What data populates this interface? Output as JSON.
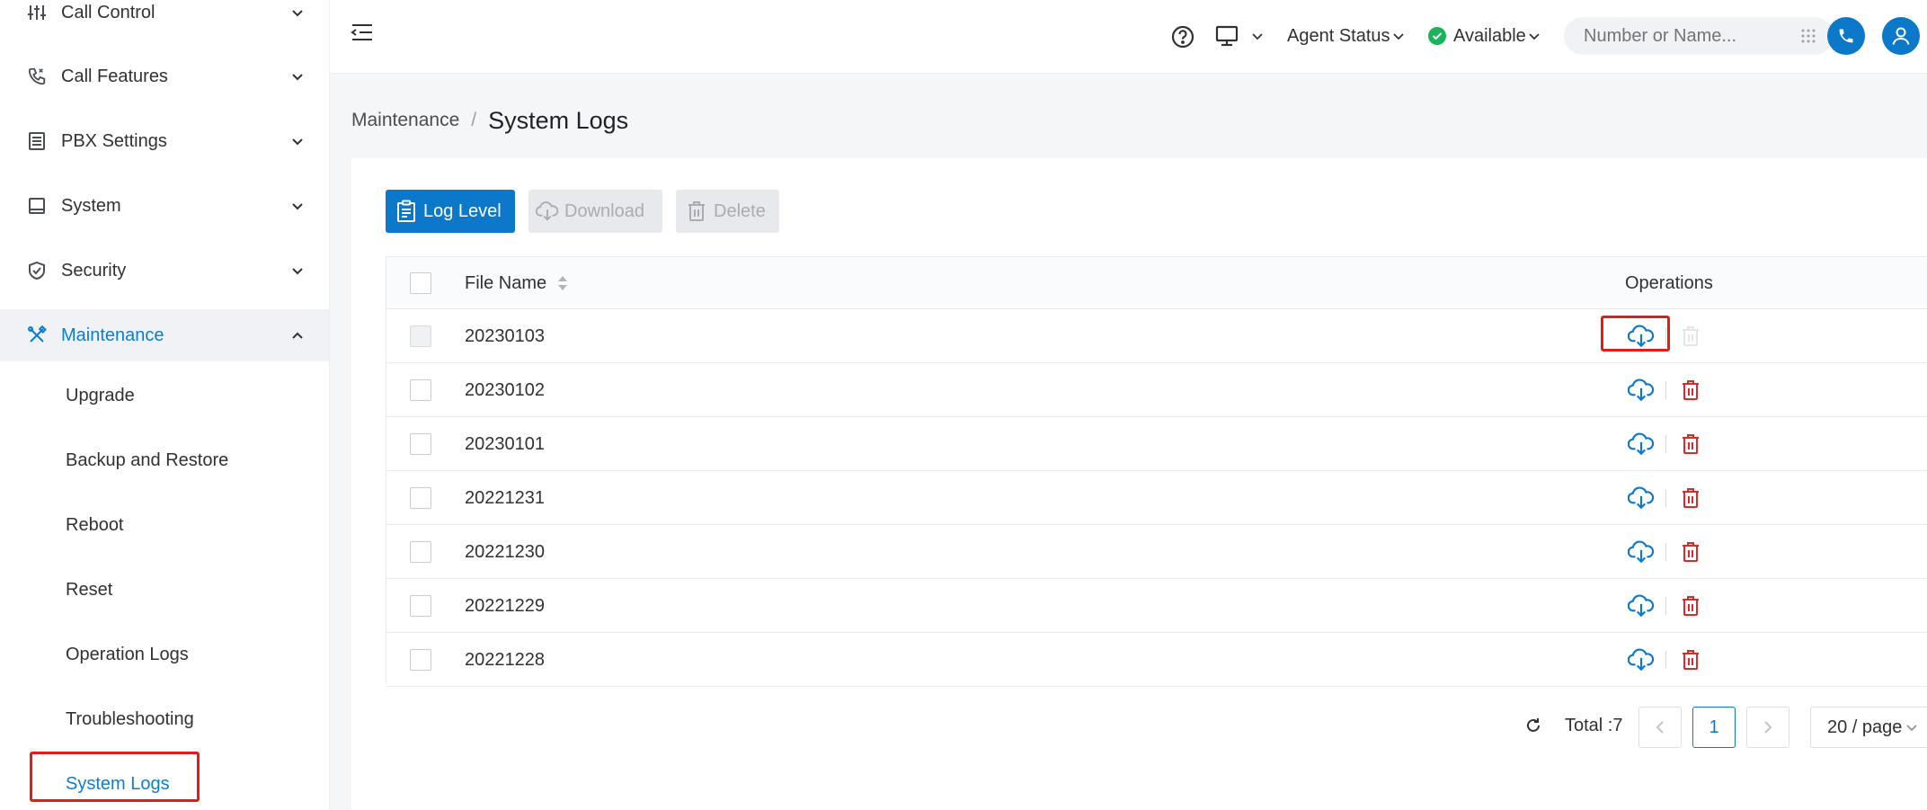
{
  "sidebar": {
    "menu": [
      {
        "label": "Call Control",
        "icon": "sliders-icon"
      },
      {
        "label": "Call Features",
        "icon": "phone-icon"
      },
      {
        "label": "PBX Settings",
        "icon": "server-icon"
      },
      {
        "label": "System",
        "icon": "monitor-icon"
      },
      {
        "label": "Security",
        "icon": "shield-icon"
      },
      {
        "label": "Maintenance",
        "icon": "tools-icon"
      }
    ],
    "submenu": [
      {
        "label": "Upgrade"
      },
      {
        "label": "Backup and Restore"
      },
      {
        "label": "Reboot"
      },
      {
        "label": "Reset"
      },
      {
        "label": "Operation Logs"
      },
      {
        "label": "Troubleshooting"
      },
      {
        "label": "System Logs"
      }
    ]
  },
  "topbar": {
    "agent_status_label": "Agent Status",
    "availability": "Available",
    "search_placeholder": "Number or Name..."
  },
  "breadcrumb": {
    "parent": "Maintenance",
    "separator": "/",
    "current": "System Logs"
  },
  "toolbar": {
    "log_level_label": "Log Level",
    "download_label": "Download",
    "delete_label": "Delete"
  },
  "table": {
    "columns": {
      "file_name": "File Name",
      "operations": "Operations"
    },
    "rows": [
      {
        "file_name": "20230103"
      },
      {
        "file_name": "20230102"
      },
      {
        "file_name": "20230101"
      },
      {
        "file_name": "20221231"
      },
      {
        "file_name": "20221230"
      },
      {
        "file_name": "20221229"
      },
      {
        "file_name": "20221228"
      }
    ]
  },
  "pagination": {
    "total_label": "Total :7",
    "current_page": "1",
    "page_size": "20 / page"
  },
  "colors": {
    "accent": "#0b78c9",
    "danger": "#e02828",
    "success": "#19b35a",
    "highlight_box": "#e21b1b"
  }
}
